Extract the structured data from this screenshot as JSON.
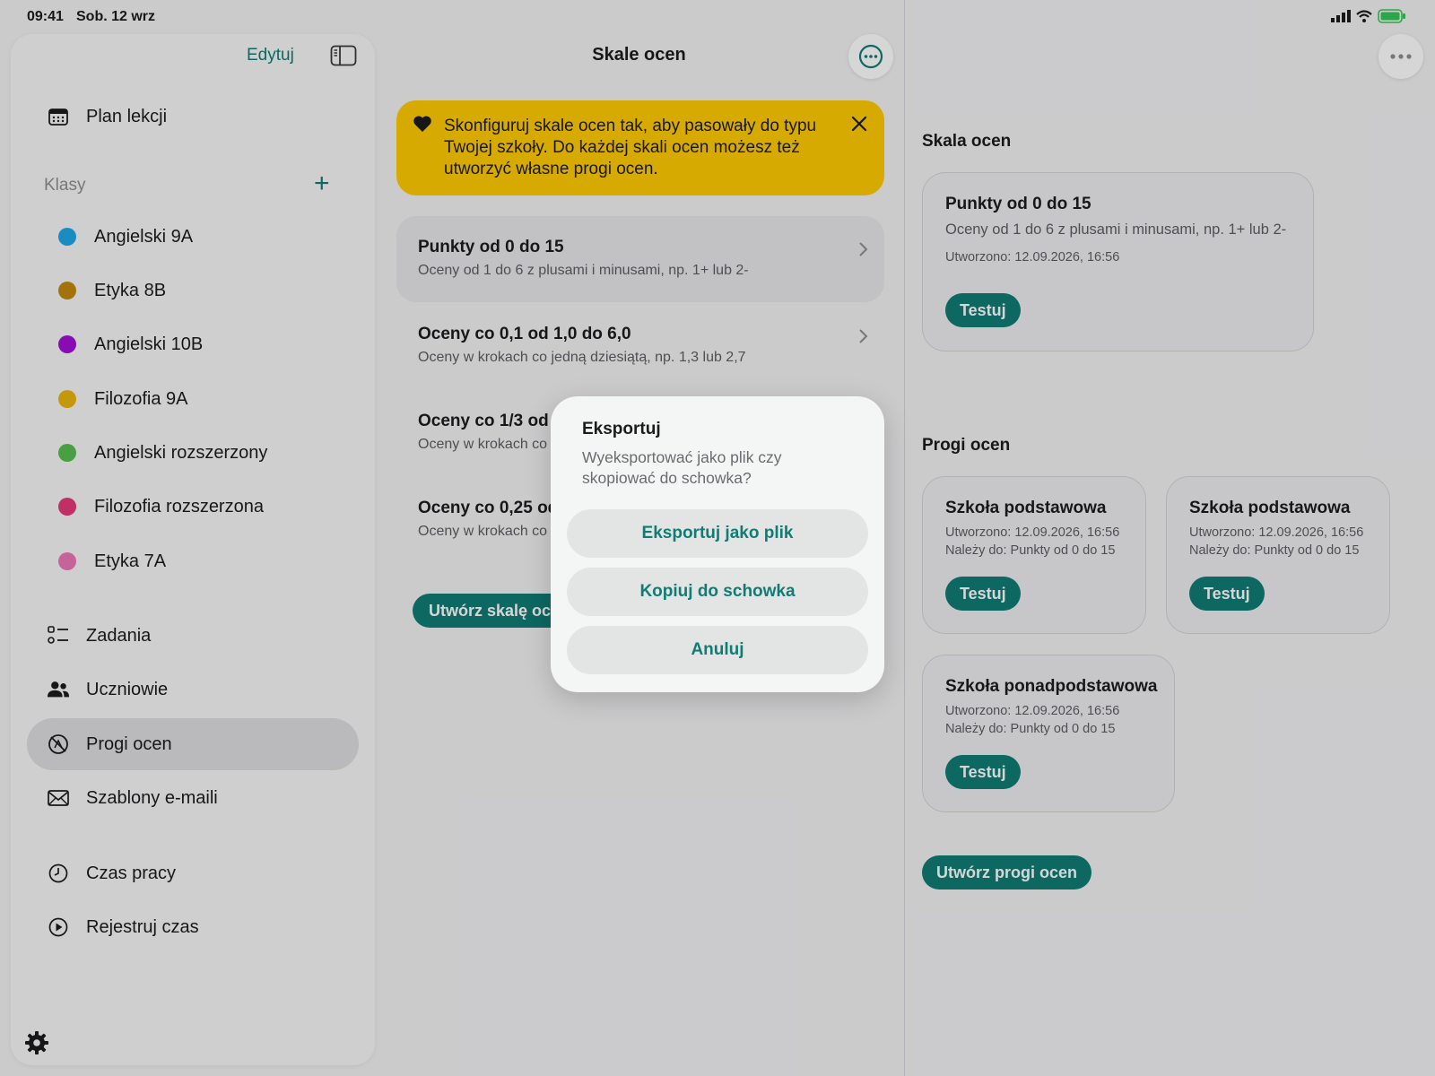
{
  "status": {
    "time": "09:41",
    "date": "Sob. 12 wrz"
  },
  "sidebar": {
    "edit_label": "Edytuj",
    "top_item": {
      "label": "Plan lekcji",
      "icon": "calendar-icon"
    },
    "classes_header": "Klasy",
    "classes": [
      {
        "label": "Angielski 9A",
        "color": "#1ea7e6"
      },
      {
        "label": "Etyka 8B",
        "color": "#c28a0c"
      },
      {
        "label": "Angielski 10B",
        "color": "#a30fd6"
      },
      {
        "label": "Filozofia 9A",
        "color": "#eab60c"
      },
      {
        "label": "Angielski rozszerzony",
        "color": "#56bf4f"
      },
      {
        "label": "Filozofia rozszerzona",
        "color": "#e5387a"
      },
      {
        "label": "Etyka 7A",
        "color": "#ec77b7"
      }
    ],
    "nav": [
      {
        "label": "Zadania",
        "icon": "tasks-list-icon"
      },
      {
        "label": "Uczniowie",
        "icon": "people-icon"
      },
      {
        "label": "Progi ocen",
        "icon": "thresholds-icon",
        "active": true
      },
      {
        "label": "Szablony e-maili",
        "icon": "envelope-icon"
      }
    ],
    "time_items": [
      {
        "label": "Czas pracy",
        "icon": "clock-icon"
      },
      {
        "label": "Rejestruj czas",
        "icon": "play-circle-icon"
      }
    ]
  },
  "middle": {
    "title": "Skale ocen",
    "banner_text": "Skonfiguruj skale ocen tak, aby pasowały do typu Twojej szkoły. Do każdej skali ocen możesz też utworzyć własne progi ocen.",
    "scales": [
      {
        "title": "Punkty od 0 do 15",
        "subtitle": "Oceny od 1 do 6 z plusami i minusami, np. 1+ lub 2-"
      },
      {
        "title": "Oceny co 0,1 od 1,0 do 6,0",
        "subtitle": "Oceny w krokach co jedną dziesiątą, np. 1,3 lub 2,7"
      },
      {
        "title": "Oceny co 1/3 od 1",
        "subtitle": "Oceny w krokach co"
      },
      {
        "title": "Oceny co 0,25 od",
        "subtitle": "Oceny w krokach co"
      }
    ],
    "create_button": "Utwórz skalę oce"
  },
  "right": {
    "scale_header": "Skala ocen",
    "scale_card": {
      "title": "Punkty od 0 do 15",
      "subtitle": "Oceny od 1 do 6 z plusami i minusami, np. 1+ lub 2-",
      "created": "Utworzono: 12.09.2026, 16:56",
      "button": "Testuj"
    },
    "thresholds_header": "Progi ocen",
    "thresholds": [
      {
        "title": "Szkoła podstawowa",
        "created": "Utworzono: 12.09.2026, 16:56",
        "belongs": "Należy do: Punkty od 0 do 15",
        "button": "Testuj"
      },
      {
        "title": "Szkoła podstawowa",
        "created": "Utworzono: 12.09.2026, 16:56",
        "belongs": "Należy do: Punkty od 0 do 15",
        "button": "Testuj"
      },
      {
        "title": "Szkoła ponadpodstawowa",
        "created": "Utworzono: 12.09.2026, 16:56",
        "belongs": "Należy do: Punkty od 0 do 15",
        "button": "Testuj"
      }
    ],
    "create_button": "Utwórz progi ocen"
  },
  "dialog": {
    "title": "Eksportuj",
    "message": "Wyeksportować jako plik czy skopiować do schowka?",
    "buttons": [
      "Eksportuj jako plik",
      "Kopiuj do schowka",
      "Anuluj"
    ]
  },
  "colors": {
    "accent": "#0f7d74",
    "banner": "#ffcb00"
  }
}
